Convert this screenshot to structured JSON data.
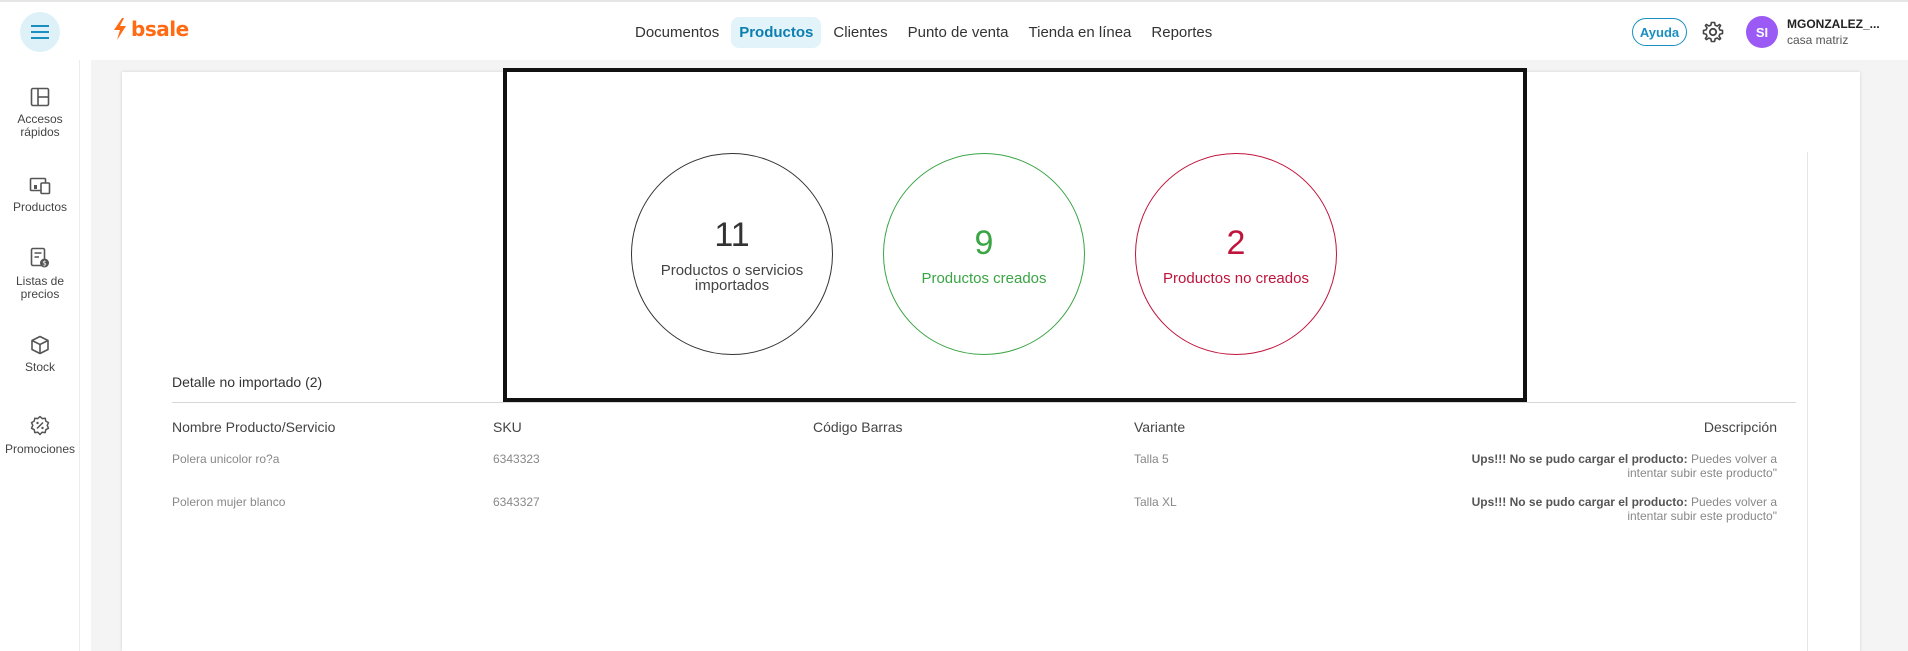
{
  "header": {
    "brand": "bsale",
    "nav": [
      {
        "label": "Documentos",
        "active": false
      },
      {
        "label": "Productos",
        "active": true
      },
      {
        "label": "Clientes",
        "active": false
      },
      {
        "label": "Punto de venta",
        "active": false
      },
      {
        "label": "Tienda en línea",
        "active": false
      },
      {
        "label": "Reportes",
        "active": false
      }
    ],
    "help_label": "Ayuda",
    "user": {
      "initials": "SI",
      "name": "MGONZALEZ_...",
      "branch": "casa matriz"
    }
  },
  "sidebar": {
    "items": [
      {
        "label_line1": "Accesos",
        "label_line2": "rápidos",
        "icon": "quick-access-icon"
      },
      {
        "label_line1": "Productos",
        "label_line2": "",
        "icon": "products-icon"
      },
      {
        "label_line1": "Listas de",
        "label_line2": "precios",
        "icon": "price-list-icon"
      },
      {
        "label_line1": "Stock",
        "label_line2": "",
        "icon": "box-icon"
      },
      {
        "label_line1": "Promociones",
        "label_line2": "",
        "icon": "promotions-icon"
      }
    ]
  },
  "summary": {
    "total": {
      "value": "11",
      "label": "Productos o servicios importados"
    },
    "created": {
      "value": "9",
      "label": "Productos creados"
    },
    "not_created": {
      "value": "2",
      "label": "Productos no creados"
    }
  },
  "detail": {
    "title": "Detalle no importado (2)",
    "columns": [
      "Nombre Producto/Servicio",
      "SKU",
      "Código Barras",
      "Variante",
      "Descripción"
    ],
    "rows": [
      {
        "name": "Polera unicolor ro?a",
        "sku": "6343323",
        "barcode": "",
        "variant": "Talla 5",
        "error_bold": "Ups!!! No se pudo cargar el producto:",
        "error_text": "Puedes volver a intentar subir este producto\""
      },
      {
        "name": "Poleron mujer blanco",
        "sku": "6343327",
        "barcode": "",
        "variant": "Talla XL",
        "error_bold": "Ups!!! No se pudo cargar el producto:",
        "error_text": "Puedes volver a intentar subir este producto\""
      }
    ]
  },
  "colors": {
    "brand": "#ff6a13",
    "accent": "#1a8fbf",
    "success": "#3aa545",
    "danger": "#c0143c",
    "avatar": "#9b59f5"
  }
}
